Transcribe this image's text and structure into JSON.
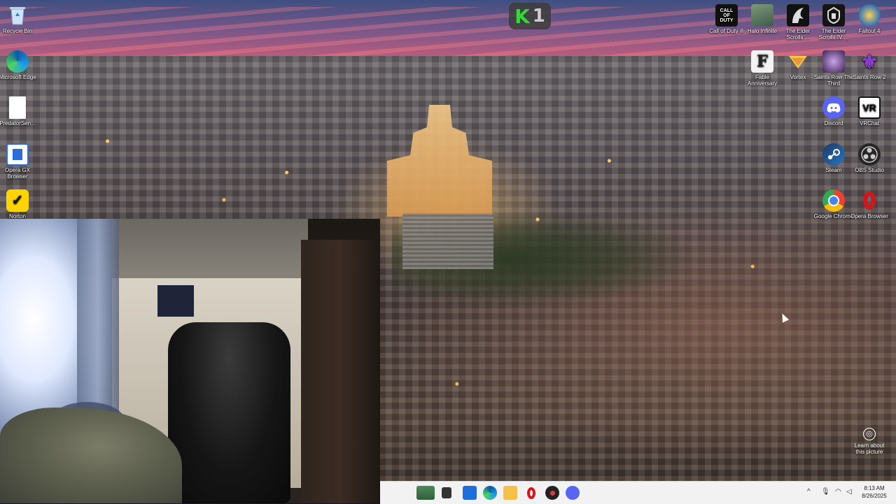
{
  "desktop": {
    "left_icons": [
      {
        "label": "Recycle Bin",
        "icon": "recycle-bin-icon"
      },
      {
        "label": "Microsoft Edge",
        "icon": "edge-icon"
      },
      {
        "label": "PredatorSen...",
        "icon": "file-icon"
      },
      {
        "label": "Opera GX Browser",
        "icon": "opera-gx-icon"
      },
      {
        "label": "Norton",
        "icon": "norton-icon"
      }
    ],
    "right_icons": [
      {
        "label": "Call of Duty ®",
        "icon": "call-of-duty-icon",
        "glyph": "CALL OF DUTY"
      },
      {
        "label": "Halo Infinite",
        "icon": "halo-infinite-icon"
      },
      {
        "label": "The Elder Scrolls ...",
        "icon": "elder-scrolls-icon"
      },
      {
        "label": "The Elder Scrolls IV ...",
        "icon": "elder-scrolls-iv-icon"
      },
      {
        "label": "Fallout 4",
        "icon": "fallout-4-icon"
      },
      {
        "label": "Fable Anniversary",
        "icon": "fable-icon",
        "glyph": "F"
      },
      {
        "label": "Vortex",
        "icon": "vortex-icon"
      },
      {
        "label": "Saints Row The Third",
        "icon": "saints-row-third-icon"
      },
      {
        "label": "Saints Row 2",
        "icon": "saints-row-2-icon"
      },
      {
        "label": "Discord",
        "icon": "discord-icon"
      },
      {
        "label": "VRChat",
        "icon": "vrchat-icon",
        "glyph": "VR"
      },
      {
        "label": "Steam",
        "icon": "steam-icon"
      },
      {
        "label": "OBS Studio",
        "icon": "obs-studio-icon"
      },
      {
        "label": "Google Chrome",
        "icon": "chrome-icon"
      },
      {
        "label": "Opera Browser",
        "icon": "opera-icon"
      }
    ],
    "k1_logo": {
      "k": "K",
      "one": "1"
    },
    "learn_about": "Learn about this picture"
  },
  "taskbar": {
    "pinned": [
      "file-explorer-icon-desk",
      "task-view-icon",
      "widgets-icon",
      "edge-icon",
      "folder-icon",
      "opera-icon",
      "steam-icon",
      "discord-icon"
    ],
    "clock_time": "8:13 AM",
    "clock_date": "8/26/2025",
    "tray_expand": "^"
  },
  "colors": {
    "taskbar_bg": "#f2f2f2",
    "k1_green": "#36d63a",
    "discord": "#5865f2",
    "opera_red": "#d7141a"
  }
}
